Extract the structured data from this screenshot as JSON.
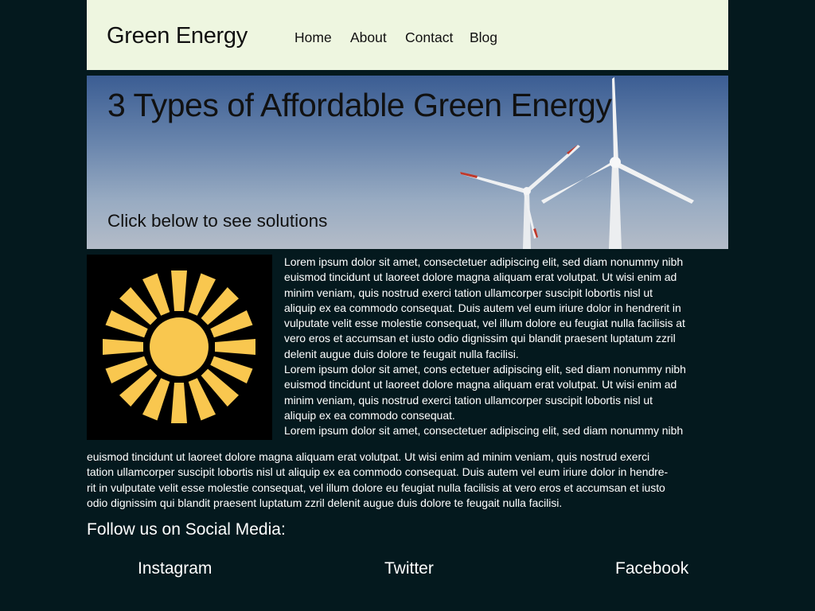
{
  "header": {
    "brand": "Green Energy",
    "nav": [
      "Home",
      "About",
      "Contact",
      "Blog"
    ]
  },
  "hero": {
    "title": "3 Types of Affordable Green Energy",
    "subtitle": "Click below to see solutions"
  },
  "content": {
    "side_lines": [
      "Lorem ipsum dolor sit amet, consectetuer adipiscing elit, sed diam nonummy nibh",
      "euismod tincidunt ut laoreet dolore magna aliquam erat volutpat. Ut wisi enim ad",
      "minim veniam, quis nostrud exerci tation ullamcorper suscipit lobortis nisl ut",
      "aliquip ex ea commodo consequat. Duis autem vel eum iriure dolor in hendrerit in",
      "vulputate velit esse molestie consequat, vel illum dolore eu feugiat nulla facilisis at",
      "vero eros et accumsan et iusto odio dignissim qui blandit praesent luptatum zzril",
      "delenit augue duis dolore te feugait nulla facilisi.",
      "Lorem ipsum dolor sit amet, cons ectetuer adipiscing elit, sed diam nonummy nibh",
      "euismod tincidunt ut laoreet dolore magna aliquam erat volutpat. Ut wisi enim ad",
      "minim veniam, quis nostrud exerci tation ullamcorper suscipit lobortis nisl ut",
      "aliquip ex ea commodo consequat.",
      "Lorem ipsum dolor sit amet, consectetuer adipiscing elit, sed diam nonummy nibh"
    ],
    "full_lines": [
      "euismod tincidunt ut laoreet dolore magna aliquam erat volutpat. Ut wisi enim ad minim veniam, quis nostrud exerci",
      "tation ullamcorper suscipit lobortis nisl ut aliquip ex ea commodo consequat. Duis autem vel eum iriure dolor in hendre-",
      "rit in vulputate velit esse molestie consequat, vel illum dolore eu feugiat nulla facilisis at vero eros et accumsan et iusto",
      "odio dignissim qui blandit praesent luptatum zzril delenit augue duis dolore te feugait nulla facilisi."
    ]
  },
  "social": {
    "heading": "Follow us on Social Media:",
    "links": [
      "Instagram",
      "Twitter",
      "Facebook"
    ]
  },
  "icons": {
    "sun": "sun-icon",
    "hero_image": "wind-turbines-photo"
  },
  "colors": {
    "page_background": "#04191e",
    "header_background": "#eef6e0",
    "sun_color": "#f9c74f",
    "turbine_tip": "#c0392b"
  }
}
